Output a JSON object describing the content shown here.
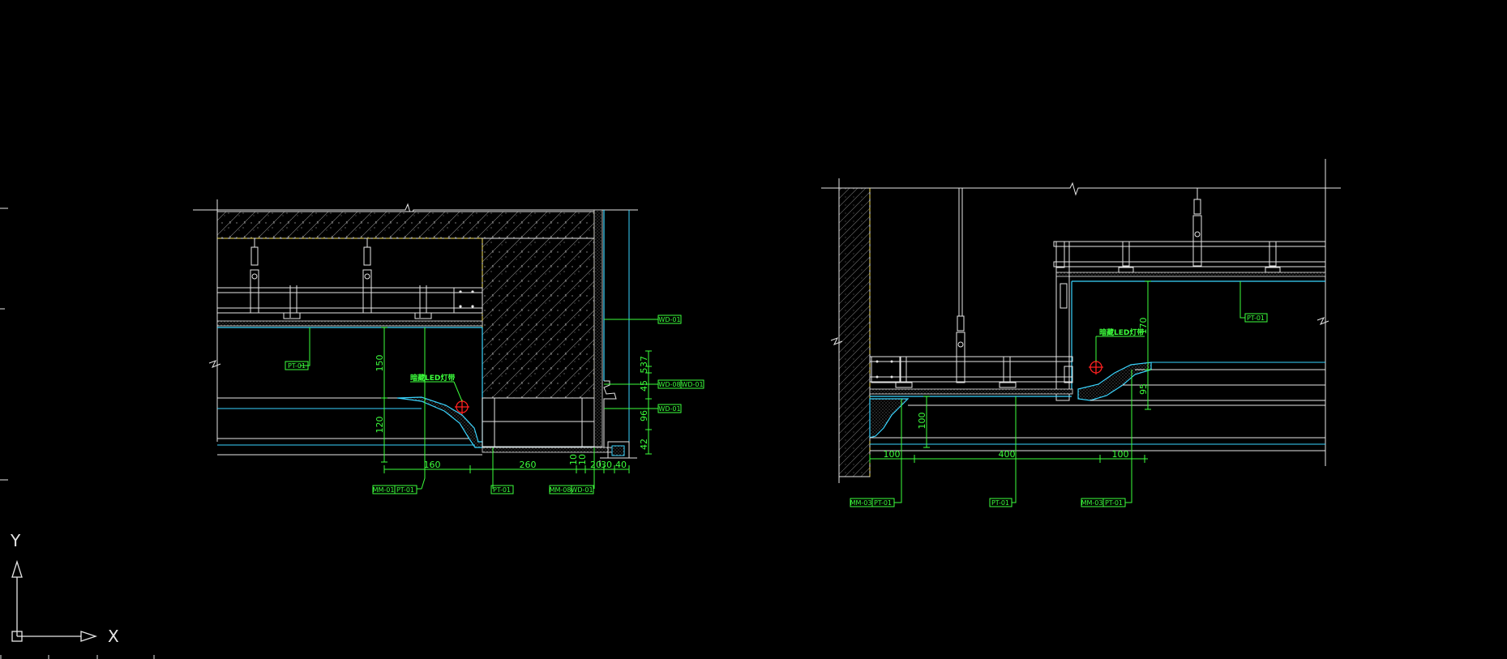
{
  "ucs": {
    "x_label": "X",
    "y_label": "Y"
  },
  "section_left": {
    "led_note": "暗藏LED灯带",
    "dims_horizontal": [
      "160",
      "260",
      "10",
      "10",
      "20",
      "30",
      "40"
    ],
    "dims_vertical_left": [
      "150",
      "120"
    ],
    "dims_vertical_right": [
      "37",
      "5",
      "45",
      "96",
      "42"
    ],
    "tags": [
      "WD-01",
      "WD-08",
      "WD-01",
      "WD-01",
      "PT-01",
      "MM-01",
      "PT-01",
      "PT-01",
      "MM-08",
      "WD-01"
    ]
  },
  "section_right": {
    "led_note": "暗藏LED灯带",
    "dims_horizontal": [
      "100",
      "400",
      "100"
    ],
    "dims_vertical": [
      "170",
      "95",
      "100"
    ],
    "tags": [
      "PT-01",
      "MM-03",
      "PT-01",
      "PT-01",
      "MM-03",
      "PT-01"
    ]
  },
  "colors": {
    "background": "#000000",
    "dimension": "#3cff3c",
    "outline": "#e6e6e6",
    "finish": "#39d5ff",
    "hidden": "#f5e05a",
    "light_symbol": "#ff2020"
  }
}
